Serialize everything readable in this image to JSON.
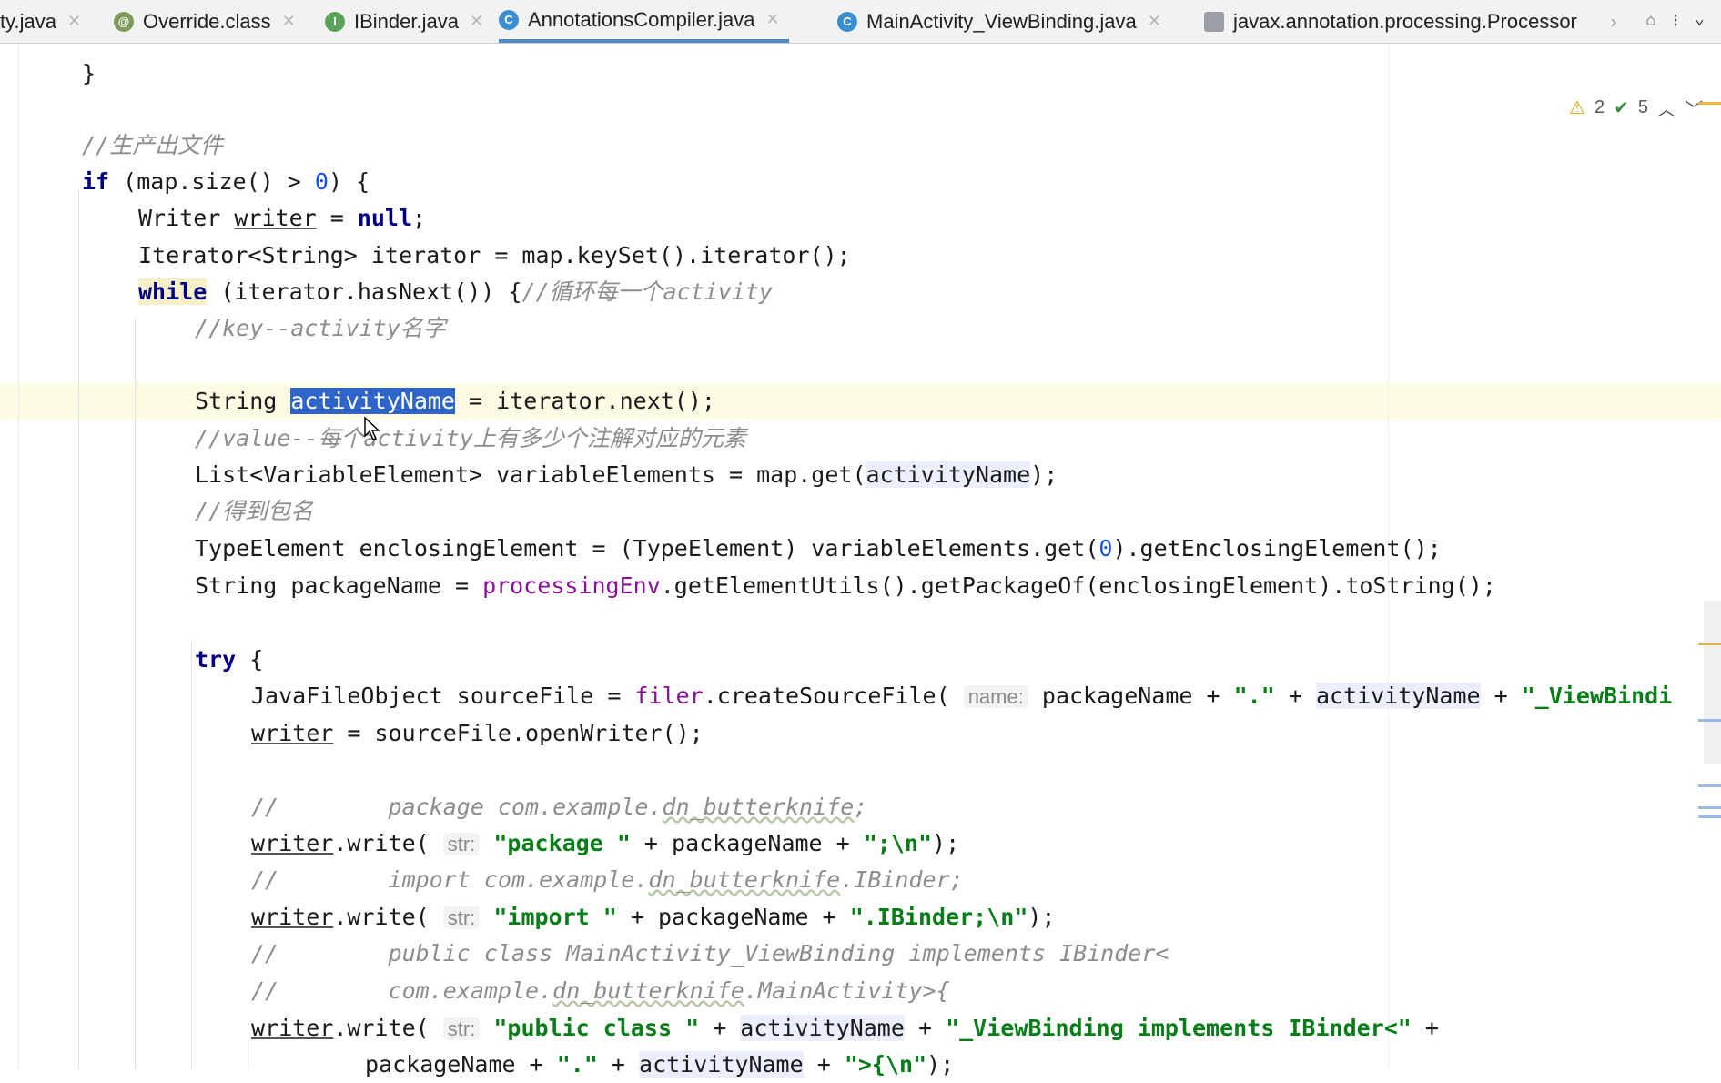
{
  "tabs": [
    {
      "label": "ty.java",
      "icon": "java-file-icon",
      "kind": "none"
    },
    {
      "label": "Override.class",
      "icon": "annotation-icon",
      "kind": "anno",
      "glyph": "@"
    },
    {
      "label": "IBinder.java",
      "icon": "interface-icon",
      "kind": "iface",
      "glyph": "I"
    },
    {
      "label": "AnnotationsCompiler.java",
      "icon": "class-icon",
      "kind": "class",
      "glyph": "C",
      "active": true
    },
    {
      "label": "MainActivity_ViewBinding.java",
      "icon": "class-icon",
      "kind": "class",
      "glyph": "C"
    },
    {
      "label": "javax.annotation.processing.Processor",
      "icon": "file-icon",
      "kind": "file",
      "glyph": ""
    }
  ],
  "inspection": {
    "warnings": "2",
    "weak_warnings": "5"
  },
  "code": {
    "l01": "}",
    "l02": "//生产出文件",
    "l03_kw": "if",
    "l03_a": " (map.size() > ",
    "l03_num": "0",
    "l03_b": ") {",
    "l04_a": "Writer ",
    "l04_var": "writer",
    "l04_b": " = ",
    "l04_kw": "null",
    "l04_c": ";",
    "l05": "Iterator<String> iterator = map.keySet().iterator();",
    "l06_kw": "while",
    "l06_a": " (iterator.hasNext()) {",
    "l06_cm": "//循环每一个activity",
    "l07": "//key--activity名字",
    "l08_a": "String ",
    "l08_sel": "activityName",
    "l08_b": " = iterator.next();",
    "l09": "//value--每个activity上有多少个注解对应的元素",
    "l10_a": "List<VariableElement> variableElements = map.get(",
    "l10_use": "activityName",
    "l10_b": ");",
    "l11": "//得到包名",
    "l12_a": "TypeElement enclosingElement = (TypeElement) variableElements.get(",
    "l12_num": "0",
    "l12_b": ").getEnclosingElement();",
    "l13_a": "String packageName = ",
    "l13_fld": "processingEnv",
    "l13_b": ".getElementUtils().getPackageOf(enclosingElement).toString();",
    "l14_kw": "try",
    "l14_a": " {",
    "l15_a": "JavaFileObject sourceFile = ",
    "l15_fld": "filer",
    "l15_b": ".createSourceFile( ",
    "l15_hint": "name:",
    "l15_c": " packageName + ",
    "l15_str1": "\".\"",
    "l15_d": " + ",
    "l15_use": "activityName",
    "l15_e": " + ",
    "l15_str2": "\"_ViewBindi",
    "l16_var": "writer",
    "l16_a": " = sourceFile.openWriter();",
    "l17_a": "//        package com.example.",
    "l17_w": "dn_butterknife",
    "l17_b": ";",
    "l18_var": "writer",
    "l18_a": ".write( ",
    "l18_hint": "str:",
    "l18_b": " ",
    "l18_str1": "\"package \"",
    "l18_c": " + packageName + ",
    "l18_str2": "\";\\n\"",
    "l18_d": ");",
    "l19_a": "//        import com.example.",
    "l19_w": "dn_butterknife",
    "l19_b": ".IBinder;",
    "l20_var": "writer",
    "l20_a": ".write( ",
    "l20_hint": "str:",
    "l20_b": " ",
    "l20_str1": "\"import \"",
    "l20_c": " + packageName + ",
    "l20_str2": "\".IBinder;\\n\"",
    "l20_d": ");",
    "l21": "//        public class MainActivity_ViewBinding implements IBinder<",
    "l22_a": "//        com.example.",
    "l22_w": "dn_butterknife",
    "l22_b": ".MainActivity>{",
    "l23_var": "writer",
    "l23_a": ".write( ",
    "l23_hint": "str:",
    "l23_b": " ",
    "l23_str1": "\"public class \"",
    "l23_c": " + ",
    "l23_use": "activityName",
    "l23_d": " + ",
    "l23_str2": "\"_ViewBinding implements IBinder<\"",
    "l23_e": " +",
    "l24_a": "packageName + ",
    "l24_str1": "\".\"",
    "l24_b": " + ",
    "l24_use": "activityName",
    "l24_c": " + ",
    "l24_str2": "\">{\\n\"",
    "l24_d": ");"
  }
}
